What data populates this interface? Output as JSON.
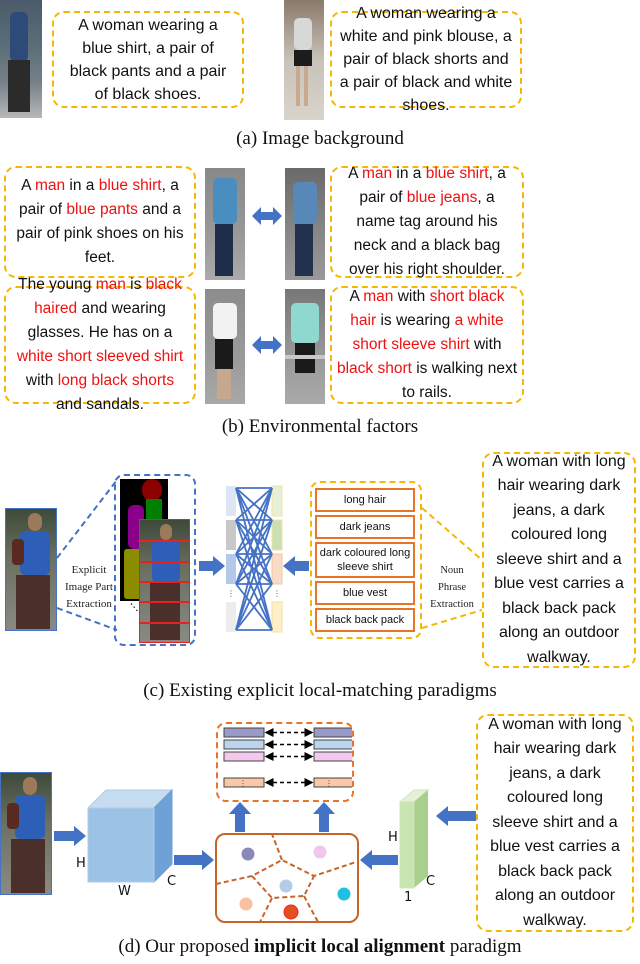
{
  "panel_a": {
    "caption": "(a) Image background",
    "left_text": "A woman wearing a blue shirt, a pair of black pants and a pair of black shoes.",
    "right_text": "A woman wearing a white and pink blouse, a pair of black shorts and a pair of black and white shoes."
  },
  "panel_b": {
    "caption": "(b) Environmental factors",
    "rows": [
      {
        "left": [
          {
            "t": "A ",
            "r": false
          },
          {
            "t": "man",
            "r": true
          },
          {
            "t": " in a ",
            "r": false
          },
          {
            "t": "blue shirt",
            "r": true
          },
          {
            "t": ", a pair of ",
            "r": false
          },
          {
            "t": "blue pants",
            "r": true
          },
          {
            "t": " and a pair of pink shoes on his feet.",
            "r": false
          }
        ],
        "right": [
          {
            "t": "A ",
            "r": false
          },
          {
            "t": "man",
            "r": true
          },
          {
            "t": " in a ",
            "r": false
          },
          {
            "t": "blue shirt",
            "r": true
          },
          {
            "t": ", a pair of ",
            "r": false
          },
          {
            "t": "blue jeans",
            "r": true
          },
          {
            "t": ", a name tag around his neck and a black bag over his right shoulder.",
            "r": false
          }
        ]
      },
      {
        "left": [
          {
            "t": "The young ",
            "r": false
          },
          {
            "t": "man",
            "r": true
          },
          {
            "t": " is ",
            "r": false
          },
          {
            "t": "black haired",
            "r": true
          },
          {
            "t": " and wearing glasses. He has on a ",
            "r": false
          },
          {
            "t": "white short sleeved shirt",
            "r": true
          },
          {
            "t": " with ",
            "r": false
          },
          {
            "t": "long black shorts",
            "r": true
          },
          {
            "t": " and sandals.",
            "r": false
          }
        ],
        "right": [
          {
            "t": "A ",
            "r": false
          },
          {
            "t": "man",
            "r": true
          },
          {
            "t": " with ",
            "r": false
          },
          {
            "t": "short black hair",
            "r": true
          },
          {
            "t": " is wearing ",
            "r": false
          },
          {
            "t": "a white short sleeve shirt",
            "r": true
          },
          {
            "t": " with ",
            "r": false
          },
          {
            "t": "black short",
            "r": true
          },
          {
            "t": " is walking next to rails.",
            "r": false
          }
        ]
      }
    ]
  },
  "panel_c": {
    "caption": "(c) Existing explicit local-matching paradigms",
    "image_part_label": [
      "Explicit",
      "Image Part",
      "Extraction"
    ],
    "noun_phrase_label": [
      "Noun",
      "Phrase",
      "Extraction"
    ],
    "phrases": [
      "long hair",
      "dark jeans",
      "dark coloured long sleeve shirt",
      "blue vest",
      "black back pack"
    ],
    "text": "A woman with long hair wearing dark jeans, a dark coloured long sleeve shirt and a blue vest carries a black back pack along an outdoor walkway."
  },
  "panel_d": {
    "caption_prefix": "(d) Our proposed ",
    "caption_bold": "implicit local alignment",
    "caption_suffix": " paradigm",
    "cube_labels": {
      "h": "H",
      "w": "W",
      "c": "C"
    },
    "text_feat_labels": {
      "h": "H",
      "one": "1",
      "c": "C"
    },
    "text": "A woman with long hair wearing dark jeans, a dark coloured long sleeve shirt and a blue vest carries a black back pack along an outdoor walkway."
  },
  "colors": {
    "dashed_box": "#f5b800",
    "highlight": "#ee1111",
    "arrow": "#4472c4",
    "orange": "#e8742a"
  }
}
